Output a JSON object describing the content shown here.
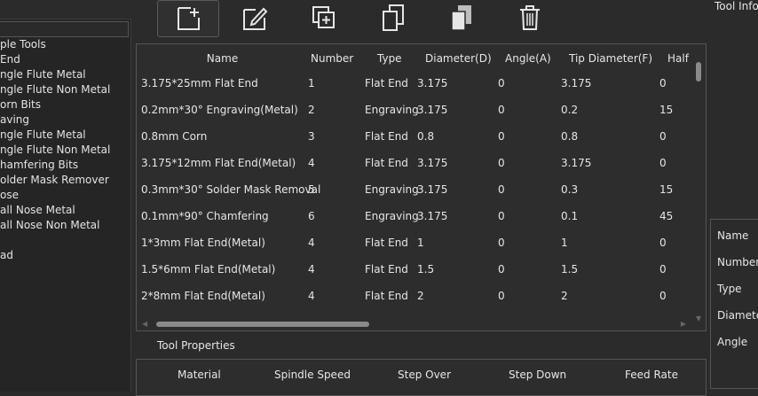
{
  "toolbar": {
    "buttons": [
      {
        "name": "new-tool-button",
        "icon": "add-document-icon"
      },
      {
        "name": "edit-tool-button",
        "icon": "edit-icon"
      },
      {
        "name": "duplicate-tool-button",
        "icon": "duplicate-icon"
      },
      {
        "name": "copy-tool-button",
        "icon": "copy-icon"
      },
      {
        "name": "paste-tool-button",
        "icon": "paste-icon"
      },
      {
        "name": "delete-tool-button",
        "icon": "trash-icon"
      }
    ]
  },
  "tree": {
    "items": [
      "ple Tools",
      "End",
      "ngle Flute Metal",
      "ngle Flute Non Metal",
      "orn Bits",
      "aving",
      "ngle Flute Metal",
      "ngle Flute Non Metal",
      "hamfering Bits",
      "older Mask Remover",
      "ose",
      "all Nose Metal",
      "all Nose Non Metal",
      "",
      "ad"
    ]
  },
  "table": {
    "headers": {
      "name": "Name",
      "number": "Number",
      "type": "Type",
      "diameter": "Diameter(D)",
      "angle": "Angle(A)",
      "tip": "Tip Diameter(F)",
      "half": "Half"
    },
    "rows": [
      {
        "name": "3.175*25mm Flat End",
        "number": "1",
        "type": "Flat End",
        "diameter": "3.175",
        "angle": "0",
        "tip": "3.175",
        "half": "0"
      },
      {
        "name": "0.2mm*30° Engraving(Metal)",
        "number": "2",
        "type": "Engraving",
        "diameter": "3.175",
        "angle": "0",
        "tip": "0.2",
        "half": "15"
      },
      {
        "name": "0.8mm Corn",
        "number": "3",
        "type": "Flat End",
        "diameter": "0.8",
        "angle": "0",
        "tip": "0.8",
        "half": "0"
      },
      {
        "name": "3.175*12mm Flat End(Metal)",
        "number": "4",
        "type": "Flat End",
        "diameter": "3.175",
        "angle": "0",
        "tip": "3.175",
        "half": "0"
      },
      {
        "name": "0.3mm*30° Solder Mask Removal",
        "number": "5",
        "type": "Engraving",
        "diameter": "3.175",
        "angle": "0",
        "tip": "0.3",
        "half": "15"
      },
      {
        "name": "0.1mm*90° Chamfering",
        "number": "6",
        "type": "Engraving",
        "diameter": "3.175",
        "angle": "0",
        "tip": "0.1",
        "half": "45"
      },
      {
        "name": "1*3mm Flat End(Metal)",
        "number": "4",
        "type": "Flat End",
        "diameter": "1",
        "angle": "0",
        "tip": "1",
        "half": "0"
      },
      {
        "name": "1.5*6mm Flat End(Metal)",
        "number": "4",
        "type": "Flat End",
        "diameter": "1.5",
        "angle": "0",
        "tip": "1.5",
        "half": "0"
      },
      {
        "name": "2*8mm Flat End(Metal)",
        "number": "4",
        "type": "Flat End",
        "diameter": "2",
        "angle": "0",
        "tip": "2",
        "half": "0"
      }
    ]
  },
  "properties": {
    "title": "Tool Properties",
    "headers": [
      "Material",
      "Spindle Speed",
      "Step Over",
      "Step Down",
      "Feed Rate"
    ]
  },
  "info": {
    "title": "Tool Info",
    "labels": [
      "Name",
      "Number",
      "Type",
      "Diamete",
      "Angle"
    ]
  },
  "colors": {
    "background": "#2b2b2b",
    "panel": "#2d2d2d",
    "border": "#555555",
    "text": "#e6e6e6"
  }
}
